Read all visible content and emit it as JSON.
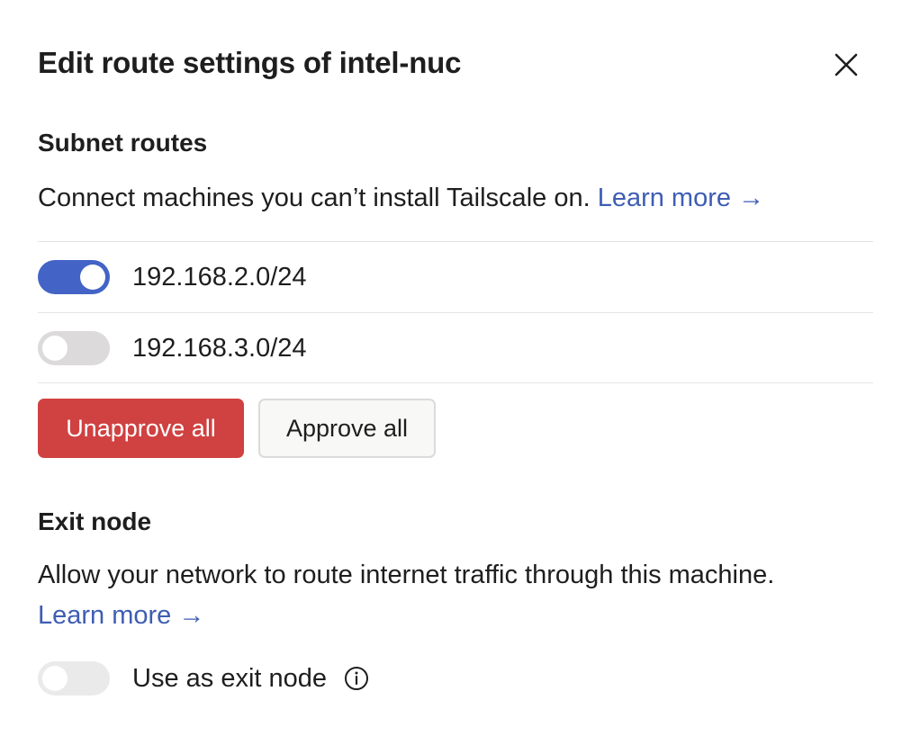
{
  "dialog": {
    "title": "Edit route settings of intel-nuc",
    "close_icon": "close-icon"
  },
  "subnet": {
    "heading": "Subnet routes",
    "description": "Connect machines you can’t install Tailscale on.",
    "learn_more": "Learn more →",
    "routes": [
      {
        "cidr": "192.168.2.0/24",
        "enabled": true
      },
      {
        "cidr": "192.168.3.0/24",
        "enabled": false
      }
    ],
    "unapprove_label": "Unapprove all",
    "approve_label": "Approve all"
  },
  "exit_node": {
    "heading": "Exit node",
    "description": "Allow your network to route internet traffic through this machine.",
    "learn_more": "Learn more →",
    "toggle_label": "Use as exit node",
    "enabled": false,
    "info_icon": "info-icon"
  },
  "colors": {
    "accent": "#4364c6",
    "link": "#3e5db3",
    "danger": "#d04141",
    "toggle_off": "#dcdadb"
  }
}
